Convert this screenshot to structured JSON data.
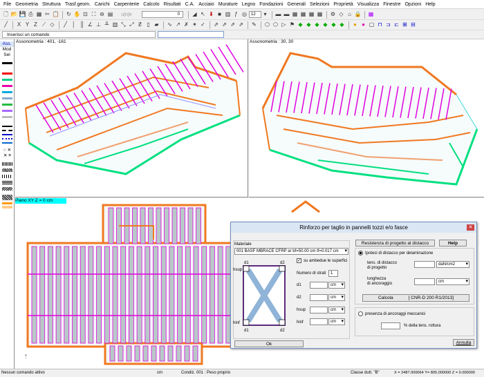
{
  "menu": [
    "File",
    "Geometria",
    "Struttura",
    "Trasf.geom.",
    "Carichi",
    "Carpenterie",
    "Calcolo",
    "Risultati",
    "C.A.",
    "Acciaio",
    "Murature",
    "Legno",
    "Fondazioni",
    "Generali",
    "Selezioni",
    "Proprietà",
    "Visualizza",
    "Finestre",
    "Opzioni",
    "Help"
  ],
  "toolbar": {
    "zoom_value": "12",
    "uinle_label": "u|n|e",
    "field_zero": "0"
  },
  "command": {
    "label": "Inserisci un comando",
    "value": ""
  },
  "leftpanel": {
    "ass": "Ass.",
    "mod": "Mod",
    "sel": "Sel"
  },
  "views": {
    "top_left": "Assonometria :  401, -161",
    "top_right": "Assonometria :  30, 30",
    "plan": "Piano XY  Z = 0 cm"
  },
  "dialog": {
    "title": "Rinforzo per taglio in pannelli tozzi e/o fasce",
    "materiale_label": "Materiale",
    "materiale_value": "001  BASF MBRACE CFRP ar  bf=50.00 cm  tf=0.017 cm",
    "ambedue_label": "su ambedue le superfici",
    "numero_strati_label": "Numero di strati",
    "numero_strati_value": "1",
    "d1_label": "d1",
    "d2_label": "d2",
    "hsup_label": "hsup",
    "hinf_label": "hinf",
    "unit_cm": "cm",
    "diag": {
      "d1_top": "d1",
      "d2_top": "d2",
      "hsup": "hsup",
      "hinf": "hinf",
      "d1_bot": "d1",
      "d2_bot": "d2"
    },
    "ok_label": "Ok",
    "resistenza_label": "Resistenza di progetto al distacco",
    "help_label": "Help",
    "ipotesi_label": "Ipotesi di distacco per delaminazione",
    "tens_label_1": "tens. di distacco",
    "tens_label_2": "di progetto",
    "tens_unit": "daN/cm2",
    "lung_label_1": "lunghezza",
    "lung_label_2": "di ancoraggio",
    "lung_unit": "cm",
    "calcola_label": "Calcola",
    "cnr_label": "[ CNR-D 200 R1/2013]",
    "presenza_label": "presenza di ancoraggi meccanici",
    "perc_label": "% della tens. rottura",
    "annulla_label": "Annulla"
  },
  "status": {
    "left": "Nessun comando attivo",
    "unit": "cm",
    "condiz": "Condiz. 001 : Peso proprio",
    "classe": "Classe dutt. \"B\"",
    "coords": "X = 2487.000064  Y= 805.000000  Z = 0.000000"
  },
  "colors": {
    "orange": "#f07820",
    "magenta": "#e000e0",
    "cyan": "#3fd8d8",
    "green": "#00e080",
    "plan_fill": "#b8c8c8",
    "title_bar": "#00ffff"
  }
}
